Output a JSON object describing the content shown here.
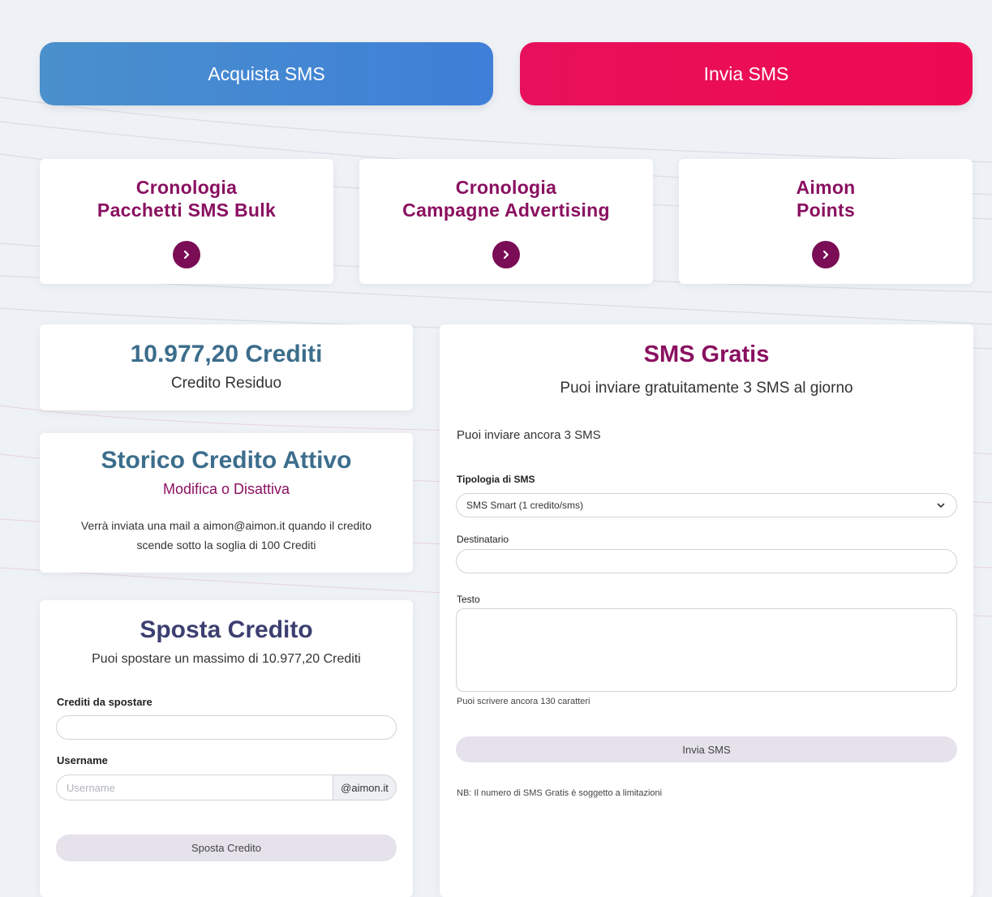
{
  "top_buttons": {
    "acquista": "Acquista SMS",
    "invia": "Invia SMS"
  },
  "nav_cards": [
    {
      "line1": "Cronologia",
      "line2": "Pacchetti SMS Bulk"
    },
    {
      "line1": "Cronologia",
      "line2": "Campagne Advertising"
    },
    {
      "line1": "Aimon",
      "line2": "Points"
    }
  ],
  "credit": {
    "amount": "10.977,20 Crediti",
    "label": "Credito Residuo"
  },
  "storico": {
    "title": "Storico Credito Attivo",
    "subtitle": "Modifica o Disattiva",
    "note": "Verrà inviata una mail a aimon@aimon.it quando il credito scende sotto la soglia di 100 Crediti"
  },
  "sposta": {
    "title": "Sposta Credito",
    "subtitle": "Puoi spostare un massimo di 10.977,20 Crediti",
    "crediti_label": "Crediti da spostare",
    "crediti_value": "",
    "username_label": "Username",
    "username_placeholder": "Username",
    "username_suffix": "@aimon.it",
    "button": "Sposta Credito"
  },
  "sms_gratis": {
    "title": "SMS Gratis",
    "subtitle": "Puoi inviare gratuitamente 3 SMS al giorno",
    "remaining": "Puoi inviare ancora 3 SMS",
    "tipologia_label": "Tipologia di SMS",
    "tipologia_value": "SMS Smart (1 credito/sms)",
    "destinatario_label": "Destinatario",
    "destinatario_value": "",
    "testo_label": "Testo",
    "chars_left": "Puoi scrivere ancora 130 caratteri",
    "button": "Invia SMS",
    "note": "NB: Il numero di SMS Gratis è soggetto a limitazioni"
  },
  "colors": {
    "blue_button": "#4a90cc",
    "pink_button": "#ee0a52",
    "magenta_text": "#8a1060",
    "teal_text": "#3c6d8c",
    "navy_text": "#3c3f70"
  },
  "icons": {
    "nav_arrow": "chevron-right-circle-icon",
    "select_arrow": "chevron-down-icon"
  }
}
